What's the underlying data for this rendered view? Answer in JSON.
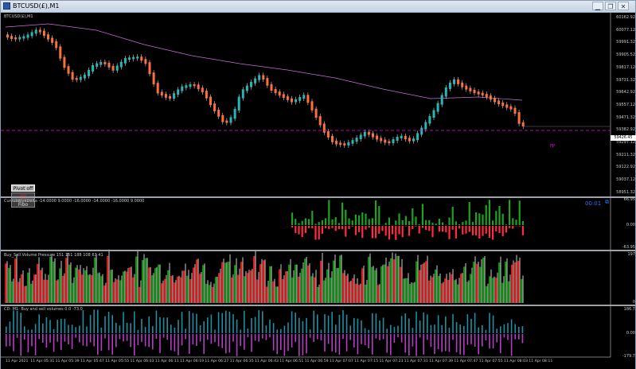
{
  "window": {
    "title": "BTCUSD(£),M1",
    "buttons": {
      "minimize": "▁",
      "restore": "❐",
      "close": "✕"
    }
  },
  "chart": {
    "header": "BTCUSD(£),M1",
    "current_price": "59426.45",
    "pivot_label": "PP",
    "timer": "00:01",
    "timer_icon": "⧉",
    "price_levels": [
      "60162.92",
      "60077.12",
      "59991.32",
      "59905.52",
      "59817.12",
      "59731.32",
      "59642.92",
      "59557.12",
      "59471.32",
      "59382.92",
      "59297.12",
      "59211.32",
      "59122.92",
      "59037.12",
      "58951.32"
    ],
    "colors": {
      "bull": "#29b6b6",
      "bear": "#ff6f3c",
      "ma": "#c86fd6",
      "pivot": "#ff00ff"
    }
  },
  "buttons": {
    "pivot_off": "Pivot off",
    "red_btn": "||||",
    "fibo": "Fibo"
  },
  "cumulative_delta": {
    "label": "CumulativeDelta -14.0000 9.0000 -16.0000 -14.0000 -16.0000 9.0000",
    "levels": [
      "66.95",
      "0.00",
      "-63.95"
    ]
  },
  "volume_pressure": {
    "label": "Buy_Sell Volume Pressure 151 151 188 108 63 41",
    "levels": [
      "197",
      "0"
    ]
  },
  "cd_volumes": {
    "label": "CD: M1: Buy and sell volumes  0.0 -73.0",
    "levels": [
      "186.7",
      "0.00",
      "-179.7"
    ]
  },
  "time_axis": [
    "11 Apr 2021",
    "11 Apr 05:31",
    "11 Apr 05:39",
    "11 Apr 05:47",
    "11 Apr 05:55",
    "11 Apr 06:03",
    "11 Apr 06:11",
    "11 Apr 06:19",
    "11 Apr 06:27",
    "11 Apr 06:35",
    "11 Apr 06:43",
    "11 Apr 06:51",
    "11 Apr 06:59",
    "11 Apr 07:07",
    "11 Apr 07:15",
    "11 Apr 07:23",
    "11 Apr 07:31",
    "11 Apr 07:39",
    "11 Apr 07:47",
    "11 Apr 07:55",
    "11 Apr 08:03",
    "11 Apr 08:11"
  ]
}
